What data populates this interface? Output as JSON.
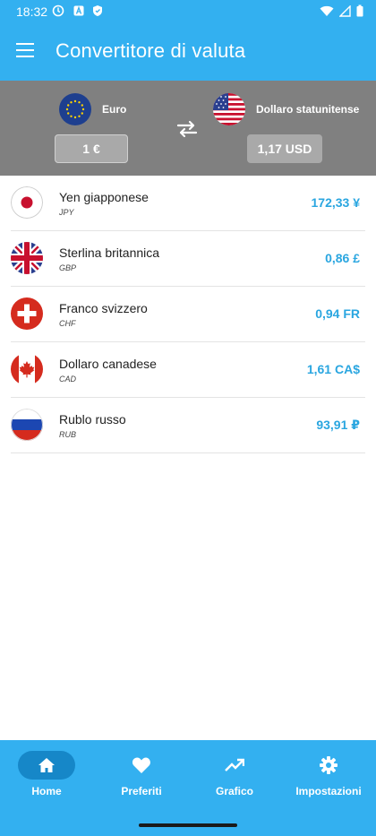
{
  "status_bar": {
    "time": "18:32"
  },
  "header": {
    "title": "Convertitore di valuta"
  },
  "converter": {
    "from": {
      "name": "Euro",
      "amount": "1 €"
    },
    "to": {
      "name": "Dollaro statunitense",
      "amount": "1,17 USD"
    }
  },
  "currencies": [
    {
      "name": "Yen giapponese",
      "code": "JPY",
      "value": "172,33 ¥"
    },
    {
      "name": "Sterlina britannica",
      "code": "GBP",
      "value": "0,86 £"
    },
    {
      "name": "Franco svizzero",
      "code": "CHF",
      "value": "0,94 FR"
    },
    {
      "name": "Dollaro canadese",
      "code": "CAD",
      "value": "1,61 CA$"
    },
    {
      "name": "Rublo russo",
      "code": "RUB",
      "value": "93,91 ₽"
    }
  ],
  "nav": {
    "items": [
      {
        "label": "Home",
        "icon": "home-icon"
      },
      {
        "label": "Preferiti",
        "icon": "heart-icon"
      },
      {
        "label": "Grafico",
        "icon": "trending-up-icon"
      },
      {
        "label": "Impostazioni",
        "icon": "gear-icon"
      }
    ],
    "active": "Home"
  },
  "colors": {
    "primary": "#33b0f0",
    "converter_bg": "#808080",
    "value_text": "#2aa6e0",
    "active_pill": "#1687c8"
  }
}
